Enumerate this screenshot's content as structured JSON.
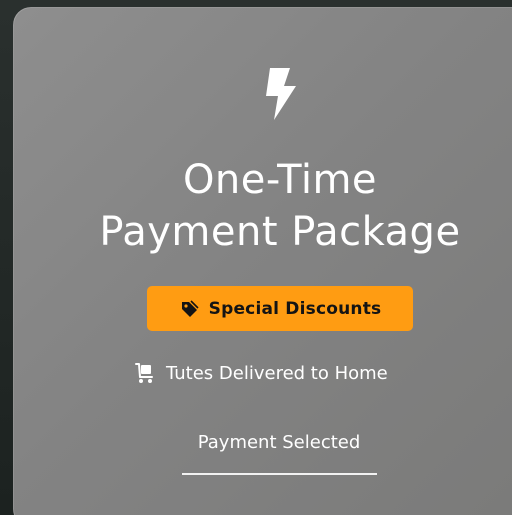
{
  "card": {
    "icon": "lightning-bolt-icon",
    "title_line1": "One-Time",
    "title_line2": "Payment Package",
    "badge": {
      "icon": "tag-icon",
      "label": "Special Discounts",
      "color": "#ff9c12"
    },
    "feature": {
      "icon": "delivery-cart-icon",
      "label": "Tutes Delivered to Home"
    },
    "status_label": "Payment Selected"
  }
}
